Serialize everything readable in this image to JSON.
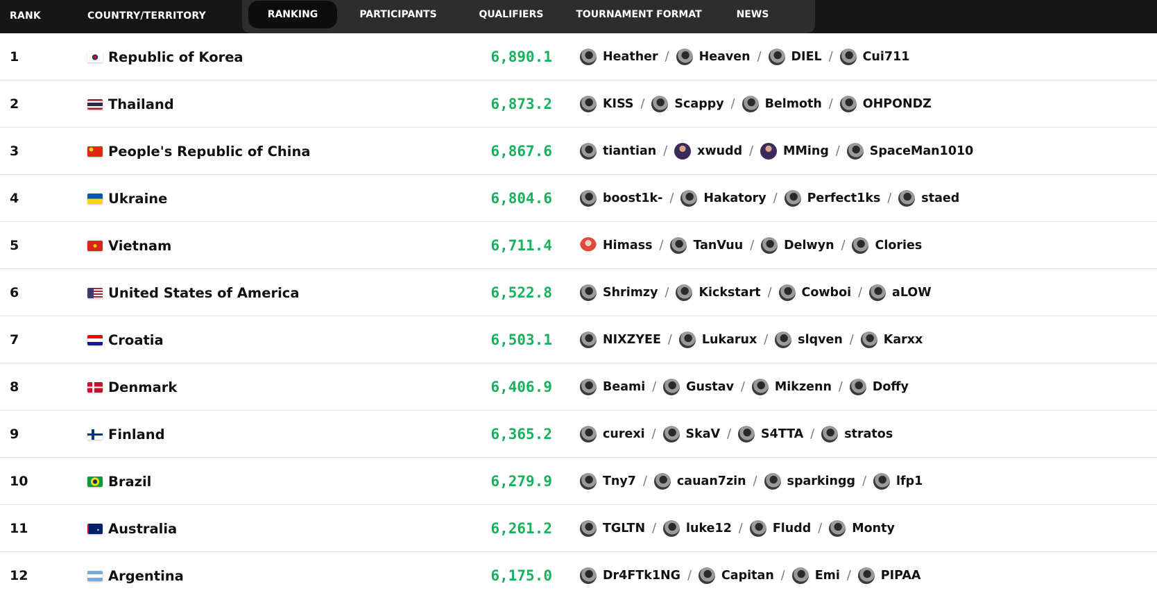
{
  "header": {
    "rank_label": "RANK",
    "country_label": "COUNTRY/TERRITORY",
    "tabs": [
      {
        "label": "RANKING",
        "active": true
      },
      {
        "label": "PARTICIPANTS",
        "active": false
      },
      {
        "label": "QUALIFIERS",
        "active": false
      },
      {
        "label": "TOURNAMENT FORMAT",
        "active": false
      },
      {
        "label": "NEWS",
        "active": false
      }
    ]
  },
  "colors": {
    "header_bg": "#161616",
    "tabs_bg": "#2d2d2d",
    "active_tab_bg": "#0d0d0d",
    "points": "#18b15c"
  },
  "rows": [
    {
      "rank": "1",
      "country": "Republic of Korea",
      "flag": "korea-flag-icon",
      "points": "6,890.1",
      "players": [
        "Heather",
        "Heaven",
        "DIEL",
        "Cui711"
      ]
    },
    {
      "rank": "2",
      "country": "Thailand",
      "flag": "thailand-flag-icon",
      "points": "6,873.2",
      "players": [
        "KISS",
        "Scappy",
        "Belmoth",
        "OHPONDZ"
      ]
    },
    {
      "rank": "3",
      "country": "People's Republic of China",
      "flag": "china-flag-icon",
      "points": "6,867.6",
      "players": [
        "tiantian",
        "xwudd",
        "MMing",
        "SpaceMan1010"
      ]
    },
    {
      "rank": "4",
      "country": "Ukraine",
      "flag": "ukraine-flag-icon",
      "points": "6,804.6",
      "players": [
        "boost1k-",
        "Hakatory",
        "Perfect1ks",
        "staed"
      ]
    },
    {
      "rank": "5",
      "country": "Vietnam",
      "flag": "vietnam-flag-icon",
      "points": "6,711.4",
      "players": [
        "Himass",
        "TanVuu",
        "Delwyn",
        "Clories"
      ]
    },
    {
      "rank": "6",
      "country": "United States of America",
      "flag": "usa-flag-icon",
      "points": "6,522.8",
      "players": [
        "Shrimzy",
        "Kickstart",
        "Cowboi",
        "aLOW"
      ]
    },
    {
      "rank": "7",
      "country": "Croatia",
      "flag": "croatia-flag-icon",
      "points": "6,503.1",
      "players": [
        "NIXZYEE",
        "Lukarux",
        "slqven",
        "Karxx"
      ]
    },
    {
      "rank": "8",
      "country": "Denmark",
      "flag": "denmark-flag-icon",
      "points": "6,406.9",
      "players": [
        "Beami",
        "Gustav",
        "Mikzenn",
        "Doffy"
      ]
    },
    {
      "rank": "9",
      "country": "Finland",
      "flag": "finland-flag-icon",
      "points": "6,365.2",
      "players": [
        "curexi",
        "SkaV",
        "S4TTA",
        "stratos"
      ]
    },
    {
      "rank": "10",
      "country": "Brazil",
      "flag": "brazil-flag-icon",
      "points": "6,279.9",
      "players": [
        "Tny7",
        "cauan7zin",
        "sparkingg",
        "lfp1"
      ]
    },
    {
      "rank": "11",
      "country": "Australia",
      "flag": "australia-flag-icon",
      "points": "6,261.2",
      "players": [
        "TGLTN",
        "luke12",
        "Fludd",
        "Monty"
      ]
    },
    {
      "rank": "12",
      "country": "Argentina",
      "flag": "argentina-flag-icon",
      "points": "6,175.0",
      "players": [
        "Dr4FTk1NG",
        "Capitan",
        "Emi",
        "PIPAA"
      ]
    }
  ]
}
